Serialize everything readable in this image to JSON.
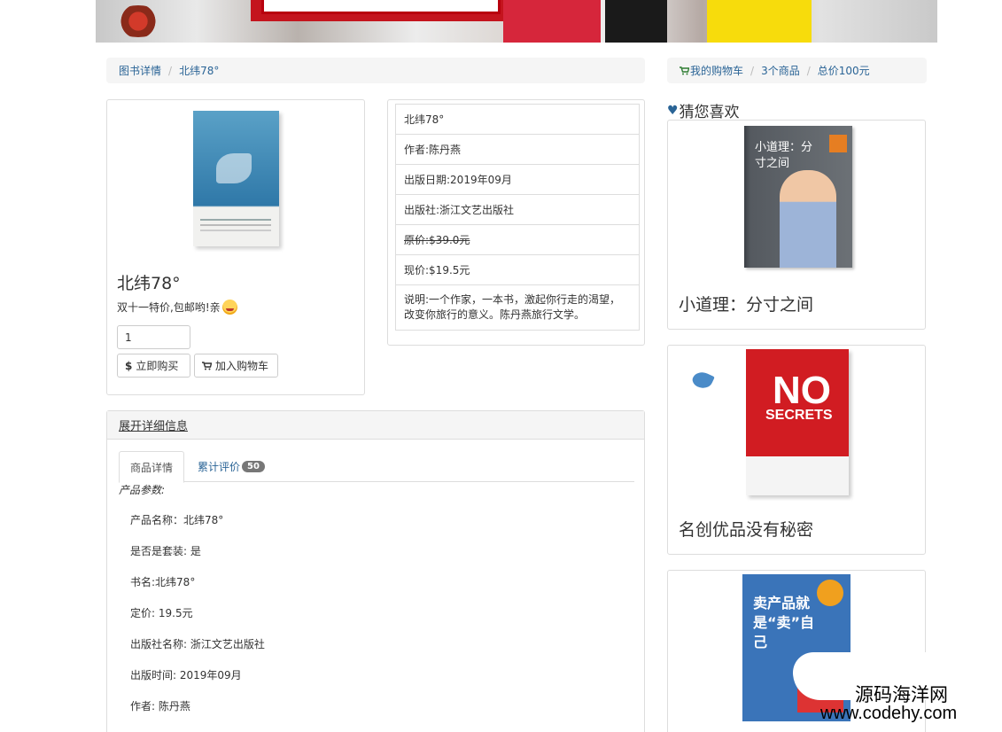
{
  "breadcrumb_left": {
    "item1": "图书详情",
    "item2": "北纬78°"
  },
  "breadcrumb_right": {
    "cart": "我的购物车",
    "count": "3个商品",
    "total": "总价100元"
  },
  "product": {
    "title": "北纬78°",
    "promo": "双十一特价,包邮哟!亲",
    "quantity": "1",
    "buy_label": "立即购买",
    "buy_icon": "$",
    "cart_label": "加入购物车"
  },
  "info": {
    "name": "北纬78°",
    "author": "作者:陈丹燕",
    "date": "出版日期:2019年09月",
    "publisher": "出版社:浙江文艺出版社",
    "original_price": "原价:$39.0元",
    "current_price": "现价:$19.5元",
    "description": "说明:一个作家，一本书，激起你行走的渴望，改变你旅行的意义。陈丹燕旅行文学。"
  },
  "details": {
    "toggle": "展开详细信息",
    "tab_detail": "商品详情",
    "tab_reviews": "累计评价",
    "review_count": "50",
    "params_title": "产品参数:",
    "params": [
      "产品名称：北纬78°",
      "是否是套装: 是",
      "书名:北纬78°",
      "定价: 19.5元",
      "出版社名称: 浙江文艺出版社",
      "出版时间: 2019年09月",
      "作者: 陈丹燕"
    ]
  },
  "recommend": {
    "title": "猜您喜欢",
    "items": [
      {
        "name": "小道理：分寸之间",
        "cover_text": "小道理：分寸之间"
      },
      {
        "name": "名创优品没有秘密",
        "cover_text_1": "NO",
        "cover_text_2": "SECRETS"
      },
      {
        "name": "",
        "cover_text": "卖产品就是“卖”自己"
      }
    ]
  },
  "watermark": {
    "cn": "源码海洋网",
    "url": "www.codehy.com"
  },
  "colors": {
    "link": "#2a6496",
    "border": "#dddddd",
    "crumb_bg": "#f5f5f5",
    "badge": "#777777"
  }
}
